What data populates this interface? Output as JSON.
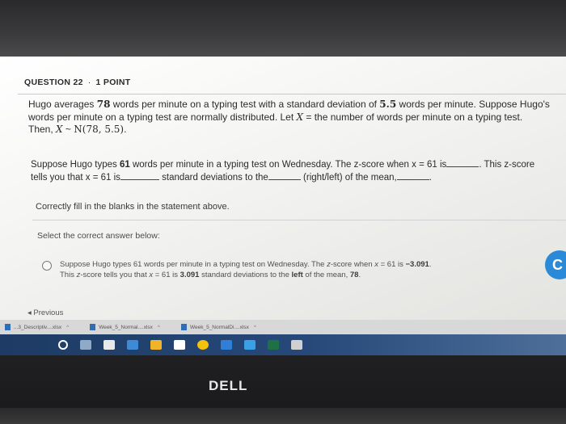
{
  "question": {
    "header_number": "QUESTION 22",
    "header_sep": "·",
    "points": "1 POINT"
  },
  "stem": {
    "l1a": "Hugo averages ",
    "l1n1": "78",
    "l1b": " words per minute on a typing test with a standard deviation of ",
    "l1n2": "5.5",
    "l1c": " words per minute. Suppose Hugo's",
    "l2a": "words per minute on a typing test are normally distributed. Let ",
    "l2x": "X",
    "l2b": " = the number of words per minute on a typing test.",
    "l3a": "Then, ",
    "l3x": "X",
    "l3b": " ~ ",
    "l3n": "N(78, 5.5)",
    "l3c": "."
  },
  "part2": {
    "l1a": "Suppose Hugo types ",
    "l1n": "61",
    "l1b": " words per minute in a typing test on Wednesday. The ",
    "l1z": "z",
    "l1c": "-score when ",
    "l1x": "x",
    "l1d": " = 61 is",
    "l1e": ". This ",
    "l1z2": "z",
    "l1f": "-score",
    "l2a": "tells you that ",
    "l2x": "x",
    "l2b": " = 61 is",
    "l2c": "standard deviations to the",
    "l2d": "(right/left) of the mean,",
    "l2e": "."
  },
  "instruction": "Correctly fill in the blanks in the statement above.",
  "select_label": "Select the correct answer below:",
  "option": {
    "l1a": "Suppose Hugo types 61 words per minute in a typing test on Wednesday. The ",
    "l1z": "z",
    "l1b": "-score when ",
    "l1x": "x",
    "l1c": " = 61 is ",
    "l1v": "−3.091",
    "l1d": ".",
    "l2a": "This ",
    "l2z": "z",
    "l2b": "-score tells you that ",
    "l2x": "x",
    "l2c": " = 61 is ",
    "l2v": "3.091",
    "l2d": " standard deviations to the ",
    "l2e": "left",
    "l2f": " of the mean, ",
    "l2g": "78",
    "l2h": "."
  },
  "previous_label": "◂ Previous",
  "downloads": [
    {
      "name": "...3_Descriptiv....xlsx"
    },
    {
      "name": "Week_5_Normal....xlsx"
    },
    {
      "name": "Week_5_NormalDi....xlsx"
    }
  ],
  "brand": "DELL",
  "colors": {
    "accent": "#2b8ad8",
    "taskbar": "#27497a"
  }
}
